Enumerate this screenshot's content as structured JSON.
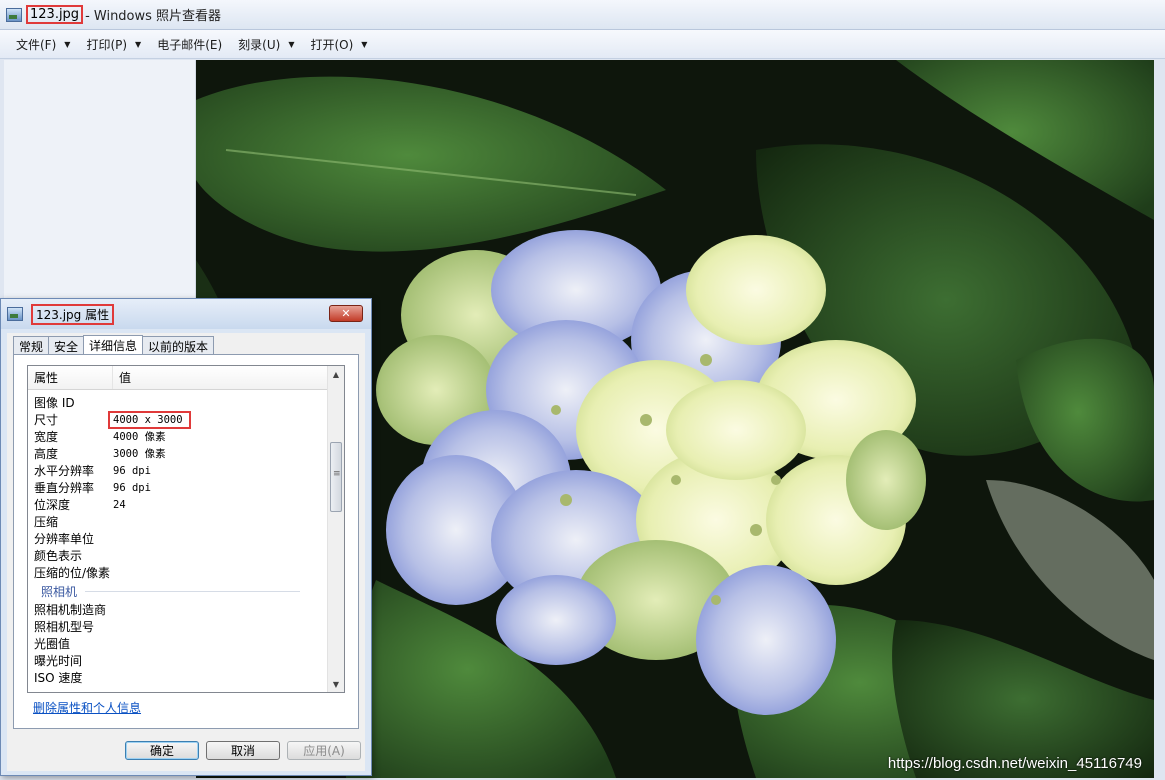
{
  "window": {
    "title_file": "123.jpg",
    "title_rest": "- Windows 照片查看器"
  },
  "menu": [
    {
      "label": "文件(F)",
      "has_arrow": true
    },
    {
      "label": "打印(P)",
      "has_arrow": true
    },
    {
      "label": "电子邮件(E)",
      "has_arrow": false
    },
    {
      "label": "刻录(U)",
      "has_arrow": true
    },
    {
      "label": "打开(O)",
      "has_arrow": true
    }
  ],
  "menu_arrow": "▼",
  "photo": {
    "subject": "hydrangea",
    "watermark": "https://blog.csdn.net/weixin_45116749"
  },
  "dialog": {
    "title": "123.jpg 属性",
    "close_label": "✕",
    "tabs": [
      {
        "label": "常规",
        "active": false
      },
      {
        "label": "安全",
        "active": false
      },
      {
        "label": "详细信息",
        "active": true
      },
      {
        "label": "以前的版本",
        "active": false
      }
    ],
    "columns": {
      "property": "属性",
      "value": "值"
    },
    "image_rows": [
      {
        "key": "图像 ID",
        "value": ""
      },
      {
        "key": "尺寸",
        "value": "4000 x 3000",
        "highlighted": true
      },
      {
        "key": "宽度",
        "value": "4000 像素"
      },
      {
        "key": "高度",
        "value": "3000 像素"
      },
      {
        "key": "水平分辨率",
        "value": "96 dpi"
      },
      {
        "key": "垂直分辨率",
        "value": "96 dpi"
      },
      {
        "key": "位深度",
        "value": "24"
      },
      {
        "key": "压缩",
        "value": ""
      },
      {
        "key": "分辨率单位",
        "value": ""
      },
      {
        "key": "颜色表示",
        "value": ""
      },
      {
        "key": "压缩的位/像素",
        "value": ""
      }
    ],
    "camera_section": "照相机",
    "camera_rows": [
      {
        "key": "照相机制造商",
        "value": ""
      },
      {
        "key": "照相机型号",
        "value": ""
      },
      {
        "key": "光圈值",
        "value": ""
      },
      {
        "key": "曝光时间",
        "value": ""
      },
      {
        "key": "ISO 速度",
        "value": ""
      }
    ],
    "remove_link": "删除属性和个人信息",
    "buttons": {
      "ok": "确定",
      "cancel": "取消",
      "apply": "应用(A)"
    },
    "scroll_up": "▲",
    "scroll_down": "▼"
  },
  "colors": {
    "highlight_box": "#e03a3a",
    "link": "#0a51c3"
  }
}
